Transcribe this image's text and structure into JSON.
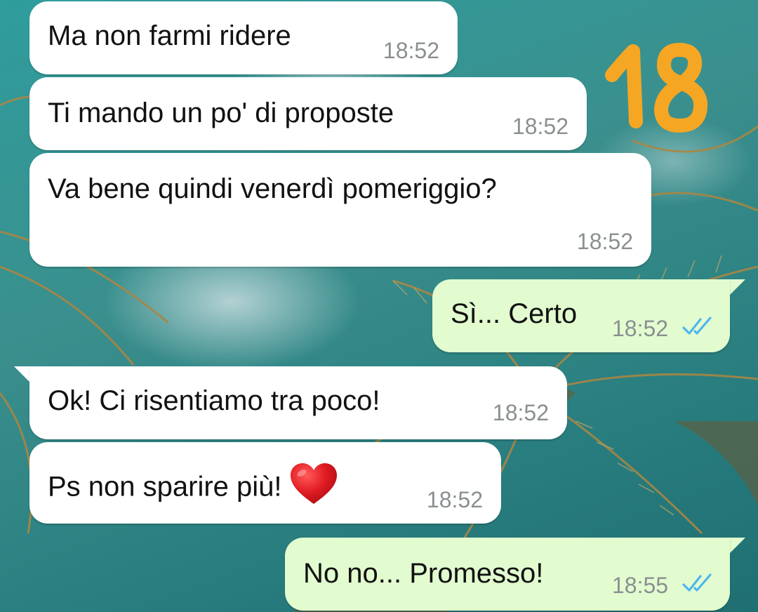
{
  "wallpaper": {
    "description_colors": {
      "sky": "#2f9d9c",
      "palm_frond": "#b08a4a"
    }
  },
  "sticker": {
    "text": "18",
    "color": "#f5a623"
  },
  "messages": [
    {
      "direction": "in",
      "text": "Ma non farmi ridere",
      "time": "18:52"
    },
    {
      "direction": "in",
      "text": "Ti mando un po' di proposte",
      "time": "18:52"
    },
    {
      "direction": "in",
      "text": "Va bene quindi venerdì pomeriggio?",
      "time": "18:52"
    },
    {
      "direction": "out",
      "text": "Sì... Certo",
      "time": "18:52",
      "status": "read"
    },
    {
      "direction": "in",
      "text": "Ok! Ci risentiamo tra poco!",
      "time": "18:52"
    },
    {
      "direction": "in",
      "text": "Ps non sparire più!",
      "emoji": "heart",
      "time": "18:52"
    },
    {
      "direction": "out",
      "text": "No no... Promesso!",
      "time": "18:55",
      "status": "read"
    }
  ],
  "colors": {
    "incoming_bubble": "#ffffff",
    "outgoing_bubble": "#e2fcd0",
    "timestamp": "#8a8f91",
    "read_ticks": "#4fb6ec"
  }
}
